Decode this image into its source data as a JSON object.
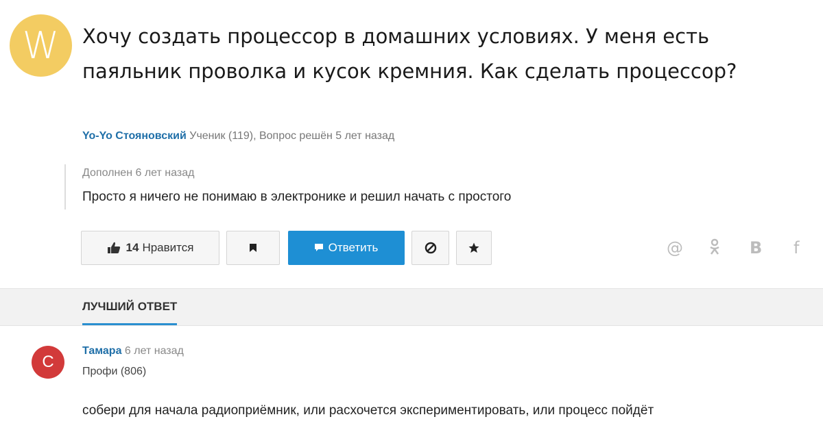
{
  "question": {
    "avatar_letter": "W",
    "title": "Хочу создать процессор в домашних условиях. У меня есть паяльник проволка и кусок кремния. Как сделать процессор?",
    "author_name": "Yo-Yo Стояновский",
    "author_meta": "Ученик (119), Вопрос решён 5 лет назад",
    "addendum_date": "Дополнен 6 лет назад",
    "addendum_text": "Просто я ничего не понимаю в электронике и решил начать с простого"
  },
  "actions": {
    "like_count": "14",
    "like_label": "Нравится",
    "answer_label": "Ответить"
  },
  "best_answer": {
    "section_title": "ЛУЧШИЙ ОТВЕТ",
    "avatar_letter": "С",
    "author_name": "Тамара",
    "time": "6 лет назад",
    "rank": "Профи (806)",
    "text": "собери для начала радиоприёмник, или расхочется экспериментировать, или процесс пойдёт"
  },
  "colors": {
    "accent": "#1e8fd4",
    "avatar_w": "#f3cc62",
    "avatar_c": "#d23a3a",
    "link": "#1f6fa8"
  },
  "icons": [
    "thumbs-up-icon",
    "flag-icon",
    "comment-icon",
    "block-icon",
    "star-icon",
    "mail-icon",
    "odnoklassniki-icon",
    "vk-icon",
    "facebook-icon"
  ]
}
